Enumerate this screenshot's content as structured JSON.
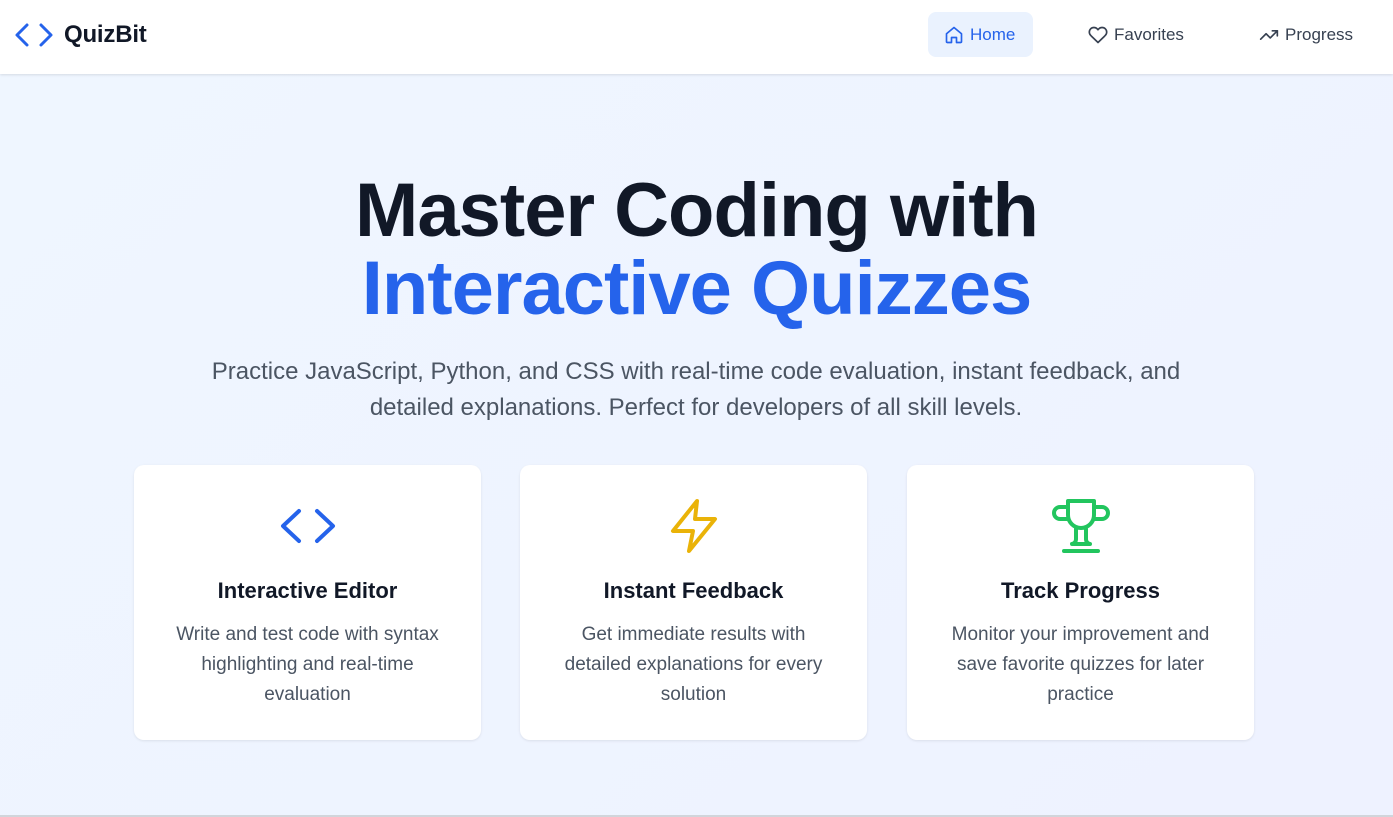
{
  "nav": {
    "brand": "QuizBit",
    "brand_icon": "code-brackets-icon",
    "items": [
      {
        "label": "Home",
        "icon": "home-icon",
        "active": true
      },
      {
        "label": "Favorites",
        "icon": "heart-icon",
        "active": false
      },
      {
        "label": "Progress",
        "icon": "trending-up-icon",
        "active": false
      }
    ]
  },
  "hero": {
    "title_line1": "Master Coding with",
    "title_line2": "Interactive Quizzes",
    "subtitle": "Practice JavaScript, Python, and CSS with real-time code evaluation, instant feedback, and detailed explanations. Perfect for developers of all skill levels."
  },
  "features": [
    {
      "title": "Interactive Editor",
      "description": "Write and test code with syntax highlighting and real-time evaluation",
      "icon": "code-brackets-icon",
      "color": "#2563eb"
    },
    {
      "title": "Instant Feedback",
      "description": "Get immediate results with detailed explanations for every solution",
      "icon": "lightning-bolt-icon",
      "color": "#eab308"
    },
    {
      "title": "Track Progress",
      "description": "Monitor your improvement and save favorite quizzes for later practice",
      "icon": "trophy-icon",
      "color": "#22c55e"
    }
  ],
  "colors": {
    "accent": "#2563eb",
    "active_nav_bg": "#eaf2fe",
    "text_dark": "#111827",
    "text_muted": "#4b5563"
  }
}
